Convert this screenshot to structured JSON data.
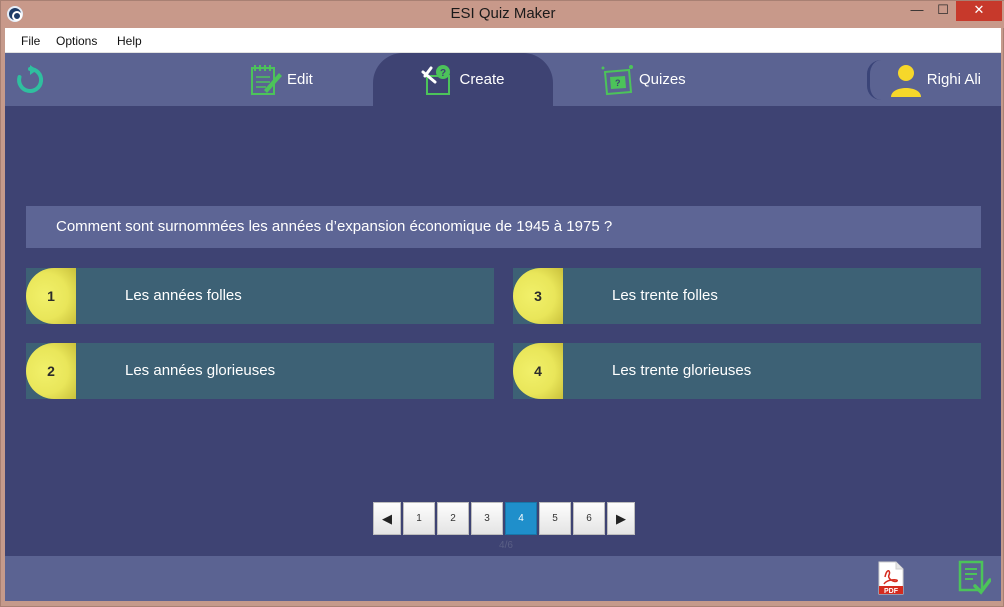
{
  "window": {
    "title": "ESI Quiz Maker"
  },
  "window_controls": {
    "minimize": "—",
    "maximize": "☐",
    "close": "✕"
  },
  "menu": {
    "items": [
      "File",
      "Options",
      "Help"
    ]
  },
  "nav": {
    "tabs": [
      {
        "label": "Edit",
        "icon": "edit-notepad-icon"
      },
      {
        "label": "Create",
        "icon": "create-tools-icon",
        "active": true
      },
      {
        "label": "Quizes",
        "icon": "quizes-icon"
      }
    ],
    "user": {
      "name": "Righi Ali"
    }
  },
  "question": {
    "text": "Comment sont surnommées les années d’expansion économique de 1945 à 1975 ?"
  },
  "answers": [
    {
      "number": "1",
      "text": "Les années folles"
    },
    {
      "number": "2",
      "text": "Les années glorieuses"
    },
    {
      "number": "3",
      "text": "Les trente folles"
    },
    {
      "number": "4",
      "text": "Les trente glorieuses"
    }
  ],
  "pager": {
    "prev": "◀",
    "next": "▶",
    "pages": [
      "1",
      "2",
      "3",
      "4",
      "5",
      "6"
    ],
    "current": "4",
    "status": "4/6"
  },
  "colors": {
    "accent_blue": "#1f8fcb",
    "number_yellow": "#e9e65a",
    "answer_bg": "#3d6175",
    "main_bg": "#3e4373",
    "icon_green": "#4cc35a"
  }
}
